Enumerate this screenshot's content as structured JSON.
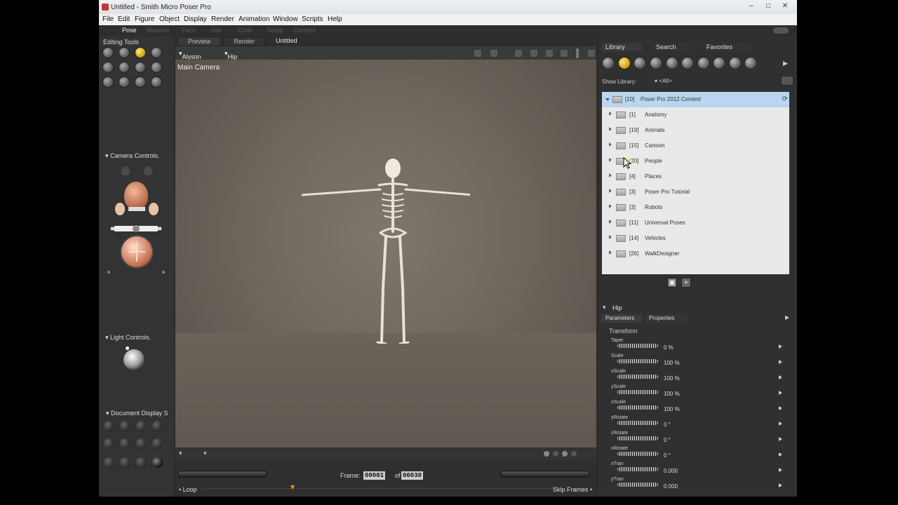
{
  "window": {
    "title": "Untitled - Smith Micro Poser Pro"
  },
  "menu": [
    "File",
    "Edit",
    "Figure",
    "Object",
    "Display",
    "Render",
    "Animation",
    "Window",
    "Scripts",
    "Help"
  ],
  "rooms": [
    "Pose",
    "Material",
    "Face",
    "Hair",
    "Cloth",
    "Setup",
    "Content"
  ],
  "left_panel": {
    "editing_tools": "Editing Tools",
    "camera_controls": "Camera Controls.",
    "light_controls": "Light Controls.",
    "document_display": "Document Display S"
  },
  "viewport": {
    "tabs": [
      "Preview",
      "Render"
    ],
    "document_title": "Untitled",
    "figure": "Alyson Skele",
    "actor": "Hip",
    "camera": "Main Camera"
  },
  "playback": {
    "frame_label": "Frame:",
    "frame": "00001",
    "of_label": "of",
    "total": "00030",
    "loop": "Loop",
    "skip_frames": "Skip Frames"
  },
  "library": {
    "tabs": [
      "Library",
      "Search",
      "Favorites"
    ],
    "show_label": "Show Library:",
    "show_value": "<All>",
    "root": {
      "count": "[10]",
      "name": "Poser Pro 2012 Content"
    },
    "folders": [
      {
        "count": "[1]",
        "name": "Anatomy"
      },
      {
        "count": "[19]",
        "name": "Animals"
      },
      {
        "count": "[15]",
        "name": "Cartoon"
      },
      {
        "count": "[20]",
        "name": "People"
      },
      {
        "count": "[4]",
        "name": "Places"
      },
      {
        "count": "[3]",
        "name": "Poser Pro Tutorial"
      },
      {
        "count": "[3]",
        "name": "Robots"
      },
      {
        "count": "[11]",
        "name": "Universal Poses"
      },
      {
        "count": "[14]",
        "name": "Vehicles"
      },
      {
        "count": "[26]",
        "name": "WalkDesigner"
      }
    ]
  },
  "parameters": {
    "actor": "Hip",
    "tabs": [
      "Parameters",
      "Properties"
    ],
    "group": "Transform",
    "items": [
      {
        "name": "Taper",
        "value": "0 %"
      },
      {
        "name": "Scale",
        "value": "100 %"
      },
      {
        "name": "xScale",
        "value": "100 %"
      },
      {
        "name": "yScale",
        "value": "100 %"
      },
      {
        "name": "zScale",
        "value": "100 %"
      },
      {
        "name": "yRotate",
        "value": "0 °"
      },
      {
        "name": "zRotate",
        "value": "0 °"
      },
      {
        "name": "xRotate",
        "value": "0 °"
      },
      {
        "name": "xTran",
        "value": "0.000"
      },
      {
        "name": "yTran",
        "value": "0.000"
      }
    ]
  },
  "colors": {
    "accent": "#e6b800",
    "selection": "#b9d5ef",
    "panel": "#303030"
  }
}
